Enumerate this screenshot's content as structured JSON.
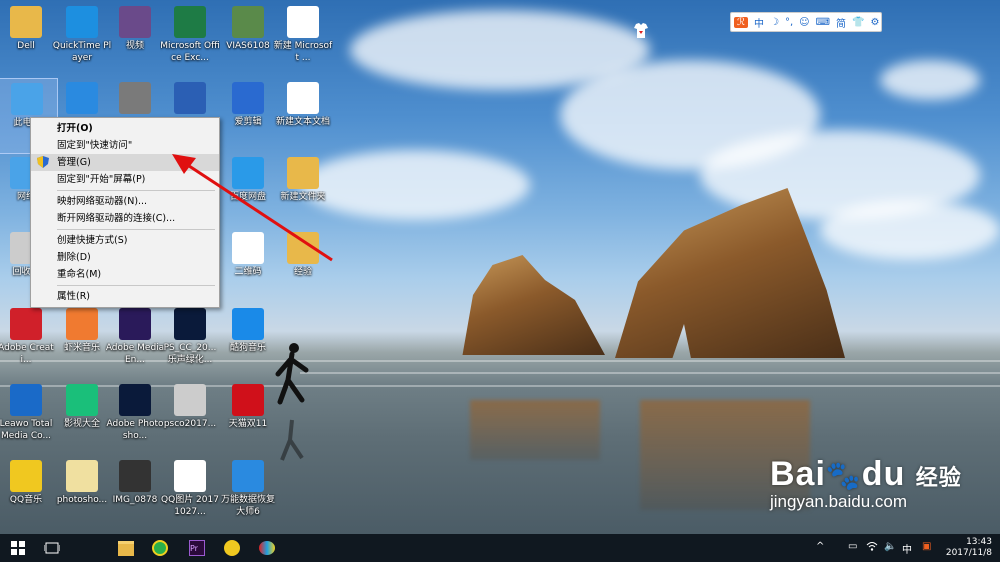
{
  "desktop_icons": [
    {
      "label": "Dell",
      "icon": "folder-user-icon",
      "color": "#e8b84a"
    },
    {
      "label": "QuickTime Player",
      "icon": "quicktime-icon",
      "color": "#1d8fe0"
    },
    {
      "label": "视频",
      "icon": "video-folder-icon",
      "color": "#6a4a8a"
    },
    {
      "label": "Microsoft Office Exc...",
      "icon": "excel-icon",
      "color": "#1e7b45"
    },
    {
      "label": "VIAS6108",
      "icon": "image-file-icon",
      "color": "#5a8a4a"
    },
    {
      "label": "新建 Microsoft ...",
      "icon": "document-icon",
      "color": "#ffffff"
    },
    {
      "label": "此电脑",
      "icon": "computer-icon",
      "color": "#4aa3e8"
    },
    {
      "label": "",
      "icon": "qq-icon",
      "color": "#2a8ae0"
    },
    {
      "label": "",
      "icon": "photo-icon",
      "color": "#7a7a7a"
    },
    {
      "label": "",
      "icon": "word-icon",
      "color": "#2b5fb4"
    },
    {
      "label": "爱剪辑",
      "icon": "video-editor-icon",
      "color": "#2a6ad0"
    },
    {
      "label": "新建文本文档",
      "icon": "text-file-icon",
      "color": "#ffffff"
    },
    {
      "label": "网络",
      "icon": "network-icon",
      "color": "#4aa3e8"
    },
    {
      "label": "百度网盘",
      "icon": "baidu-netdisk-icon",
      "color": "#2a9ae8"
    },
    {
      "label": "新建文件夹",
      "icon": "folder-icon",
      "color": "#e8b84a"
    },
    {
      "label": "回收站",
      "icon": "recycle-bin-icon",
      "color": "#cccccc"
    },
    {
      "label": "二维码",
      "icon": "document-icon",
      "color": "#ffffff"
    },
    {
      "label": "经验",
      "icon": "folder-icon",
      "color": "#e8b84a"
    },
    {
      "label": "Adobe Creati...",
      "icon": "creative-cloud-icon",
      "color": "#d0202a"
    },
    {
      "label": "虾米音乐",
      "icon": "xiami-icon",
      "color": "#f07a30"
    },
    {
      "label": "Adobe Media En...",
      "icon": "media-encoder-icon",
      "color": "#2a1a5a"
    },
    {
      "label": "PS_CC_20... 乐声绿化...",
      "icon": "photoshop-icon",
      "color": "#0a1a3a"
    },
    {
      "label": "酷狗音乐",
      "icon": "kugou-icon",
      "color": "#1a8ae8"
    },
    {
      "label": "Leawo Total Media Co...",
      "icon": "leawo-icon",
      "color": "#1a6ac8"
    },
    {
      "label": "影视大全",
      "icon": "video-app-icon",
      "color": "#1abf7a"
    },
    {
      "label": "Adobe Photosho...",
      "icon": "photoshop-icon",
      "color": "#0a1a3a"
    },
    {
      "label": "psco2017...",
      "icon": "installer-icon",
      "color": "#cccccc"
    },
    {
      "label": "天猫双11",
      "icon": "tmall-icon",
      "color": "#d0101a"
    },
    {
      "label": "QQ音乐",
      "icon": "qq-music-icon",
      "color": "#f0c820"
    },
    {
      "label": "photosho...",
      "icon": "folder-icon",
      "color": "#f0e0a0"
    },
    {
      "label": "IMG_0878",
      "icon": "photo-icon",
      "color": "#333333"
    },
    {
      "label": "QQ图片 20171027...",
      "icon": "image-file-icon",
      "color": "#ffffff"
    },
    {
      "label": "万能数据恢复大师6",
      "icon": "recovery-icon",
      "color": "#2a8ae0"
    }
  ],
  "context_menu": {
    "items": [
      {
        "label": "打开(O)",
        "bold": true
      },
      {
        "label": "固定到\"快速访问\""
      },
      {
        "label": "管理(G)",
        "shield": true,
        "highlight": true
      },
      {
        "label": "固定到\"开始\"屏幕(P)"
      },
      {
        "sep": true
      },
      {
        "label": "映射网络驱动器(N)..."
      },
      {
        "label": "断开网络驱动器的连接(C)..."
      },
      {
        "sep": true
      },
      {
        "label": "创建快捷方式(S)"
      },
      {
        "label": "删除(D)"
      },
      {
        "label": "重命名(M)"
      },
      {
        "sep": true
      },
      {
        "label": "属性(R)"
      }
    ]
  },
  "lang_bar": {
    "items": [
      "中",
      "☽",
      "°,",
      "☺",
      "⌨",
      "简",
      "👕",
      "⚙"
    ]
  },
  "taskbar": {
    "apps": [
      "start-icon",
      "task-view-icon",
      "file-explorer-icon",
      "360-browser-icon",
      "premiere-icon",
      "qq-music-icon",
      "paint-icon"
    ],
    "tray": [
      "^",
      "▭",
      "🔈",
      "中",
      "▣"
    ],
    "time": "13:43",
    "date": "2017/11/8"
  },
  "watermark": {
    "brand": "Bai",
    "brand2": "du",
    "suffix": "经验",
    "url": "jingyan.baidu.com"
  },
  "colors": {
    "arrow": "#e01010",
    "taskbar": "#101820",
    "menu_bg": "#f2f2f2"
  }
}
